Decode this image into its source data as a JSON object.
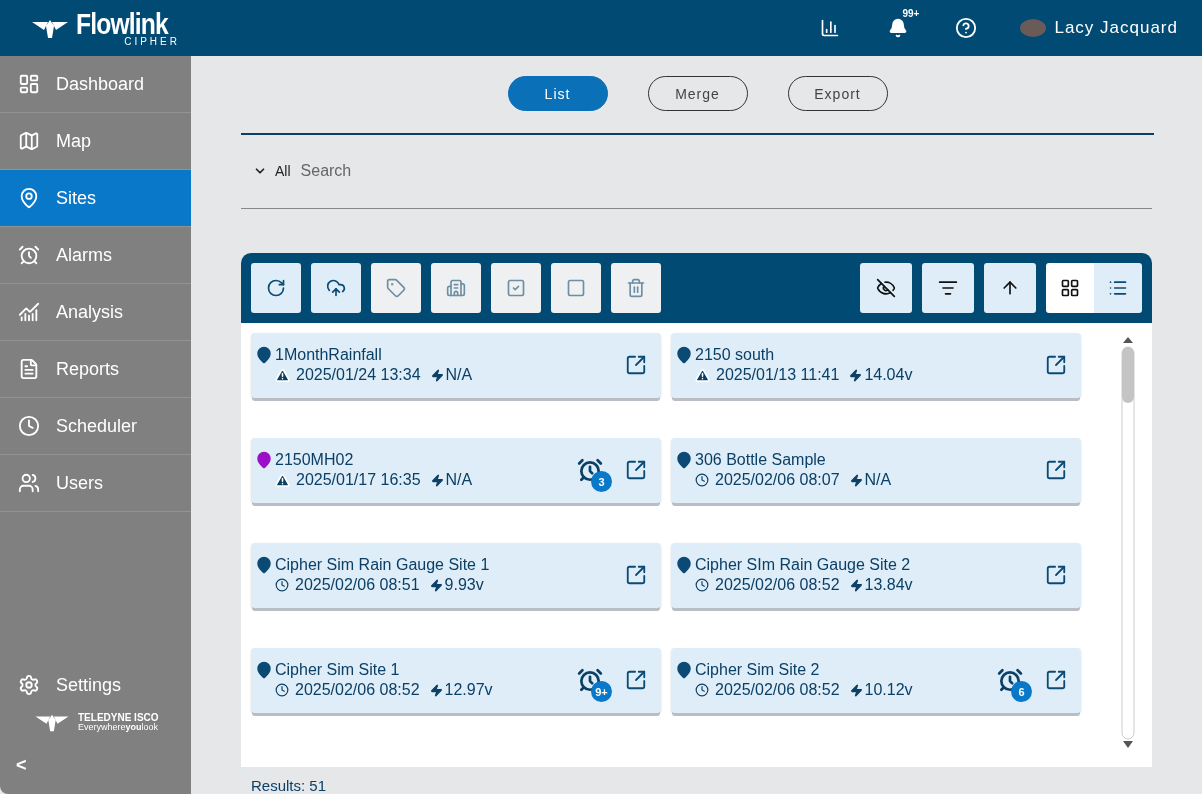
{
  "header": {
    "brand": "Flowlink",
    "brand_sub": "CIPHER",
    "notification_count": "99+",
    "user_name": "Lacy Jacquard"
  },
  "sidebar": {
    "items": [
      {
        "label": "Dashboard",
        "selected": false
      },
      {
        "label": "Map",
        "selected": false
      },
      {
        "label": "Sites",
        "selected": true
      },
      {
        "label": "Alarms",
        "selected": false
      },
      {
        "label": "Analysis",
        "selected": false
      },
      {
        "label": "Reports",
        "selected": false
      },
      {
        "label": "Scheduler",
        "selected": false
      },
      {
        "label": "Users",
        "selected": false
      }
    ],
    "settings": "Settings",
    "company": "TELEDYNE ISCO",
    "tagline": "Everywhere**you**look",
    "collapse": "<"
  },
  "tabs": [
    {
      "label": "List",
      "selected": true
    },
    {
      "label": "Merge",
      "selected": false
    },
    {
      "label": "Export",
      "selected": false
    }
  ],
  "filter": {
    "scope": "All",
    "placeholder": "Search"
  },
  "toolbar": {
    "left": [
      {
        "disabled": false
      },
      {
        "disabled": false
      },
      {
        "disabled": true
      },
      {
        "disabled": true
      },
      {
        "disabled": true
      },
      {
        "disabled": true
      },
      {
        "disabled": true
      }
    ],
    "views": [
      {
        "selected": true
      },
      {
        "selected": false
      }
    ]
  },
  "sites": [
    {
      "name": "1MonthRainfall",
      "kind": "warning",
      "time": "2025/01/24 13:34",
      "battery": "N/A",
      "color": "#0b4a75"
    },
    {
      "name": "2150 south",
      "kind": "warning",
      "time": "2025/01/13 11:41",
      "battery": "14.04v",
      "color": "#0b4a75"
    },
    {
      "name": "2150MH02",
      "kind": "warning",
      "time": "2025/01/17 16:35",
      "battery": "N/A",
      "color": "#9b10c8",
      "alarms": "3"
    },
    {
      "name": "306 Bottle Sample",
      "kind": "clock",
      "time": "2025/02/06 08:07",
      "battery": "N/A",
      "color": "#0b4a75"
    },
    {
      "name": "Cipher Sim Rain Gauge Site 1",
      "kind": "clock",
      "time": "2025/02/06 08:51",
      "battery": "9.93v",
      "color": "#0b4a75"
    },
    {
      "name": "Cipher SIm Rain Gauge Site 2",
      "kind": "clock",
      "time": "2025/02/06 08:52",
      "battery": "13.84v",
      "color": "#0b4a75"
    },
    {
      "name": "Cipher Sim Site 1",
      "kind": "clock",
      "time": "2025/02/06 08:52",
      "battery": "12.97v",
      "color": "#0b4a75",
      "alarms": "9+"
    },
    {
      "name": "Cipher Sim Site 2",
      "kind": "clock",
      "time": "2025/02/06 08:52",
      "battery": "10.12v",
      "color": "#0b4a75",
      "alarms": "6"
    }
  ],
  "results": "Results: 51"
}
